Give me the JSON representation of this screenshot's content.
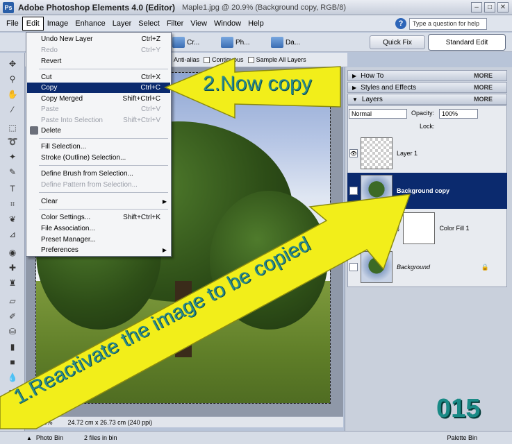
{
  "window": {
    "app_title": "Adobe Photoshop Elements 4.0 (Editor)",
    "doc_title": "Maple1.jpg @ 20.9% (Background copy, RGB/8)"
  },
  "menubar": {
    "items": [
      "File",
      "Edit",
      "Image",
      "Enhance",
      "Layer",
      "Select",
      "Filter",
      "View",
      "Window",
      "Help"
    ],
    "help_placeholder": "Type a question for help"
  },
  "shortcuts": {
    "items": [
      "Cr...",
      "Ph...",
      "Da..."
    ],
    "quick_fix": "Quick Fix",
    "standard_edit": "Standard Edit"
  },
  "options": {
    "anti_alias": "Anti-alias",
    "contiguous": "Contiguous",
    "sample_all": "Sample All Layers"
  },
  "edit_menu": {
    "items": [
      {
        "label": "Undo New Layer",
        "shortcut": "Ctrl+Z"
      },
      {
        "label": "Redo",
        "shortcut": "Ctrl+Y"
      },
      {
        "label": "Revert",
        "shortcut": ""
      },
      {
        "label": "Cut",
        "shortcut": "Ctrl+X"
      },
      {
        "label": "Copy",
        "shortcut": "Ctrl+C"
      },
      {
        "label": "Copy Merged",
        "shortcut": "Shift+Ctrl+C"
      },
      {
        "label": "Paste",
        "shortcut": "Ctrl+V"
      },
      {
        "label": "Paste Into Selection",
        "shortcut": "Shift+Ctrl+V"
      },
      {
        "label": "Delete",
        "shortcut": ""
      },
      {
        "label": "Fill Selection...",
        "shortcut": ""
      },
      {
        "label": "Stroke (Outline) Selection...",
        "shortcut": ""
      },
      {
        "label": "Define Brush from Selection...",
        "shortcut": ""
      },
      {
        "label": "Define Pattern from Selection...",
        "shortcut": ""
      },
      {
        "label": "Clear",
        "shortcut": ""
      },
      {
        "label": "Color Settings...",
        "shortcut": "Shift+Ctrl+K"
      },
      {
        "label": "File Association...",
        "shortcut": ""
      },
      {
        "label": "Preset Manager...",
        "shortcut": ""
      },
      {
        "label": "Preferences",
        "shortcut": ""
      }
    ]
  },
  "palette": {
    "how_to": "How To",
    "styles": "Styles and Effects",
    "layers": "Layers",
    "more": "MORE",
    "blend_mode": "Normal",
    "opacity_label": "Opacity:",
    "opacity_value": "100%",
    "lock_label": "Lock:",
    "layers_list": [
      "Layer 1",
      "Background copy",
      "Color Fill 1",
      "Background"
    ]
  },
  "status": {
    "zoom": "20.93%",
    "doc_size": "24.72 cm x 26.73 cm (240 ppi)"
  },
  "bottom": {
    "photo_bin": "Photo Bin",
    "files_info": "2 files in bin",
    "palette_bin": "Palette Bin"
  },
  "annotations": {
    "step2": "2.Now copy",
    "step1": "1.Reactivate the image to be copied",
    "frame": "015"
  },
  "colors": {
    "selection_highlight": "#0b2a6e",
    "arrow_yellow": "#f2ee1a",
    "annotation_text": "#2a8a8a"
  }
}
